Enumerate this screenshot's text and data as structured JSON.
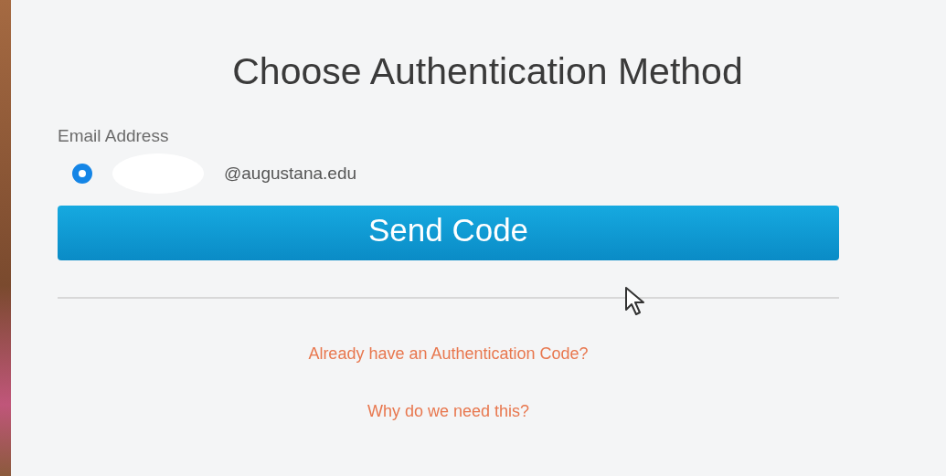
{
  "title": "Choose Authentication Method",
  "email_field": {
    "label": "Email Address",
    "options": [
      {
        "text": "@augustana.edu",
        "selected": true
      }
    ]
  },
  "send_button": {
    "label": "Send Code"
  },
  "links": [
    "Already have an Authentication Code?",
    "Why do we need this?"
  ]
}
